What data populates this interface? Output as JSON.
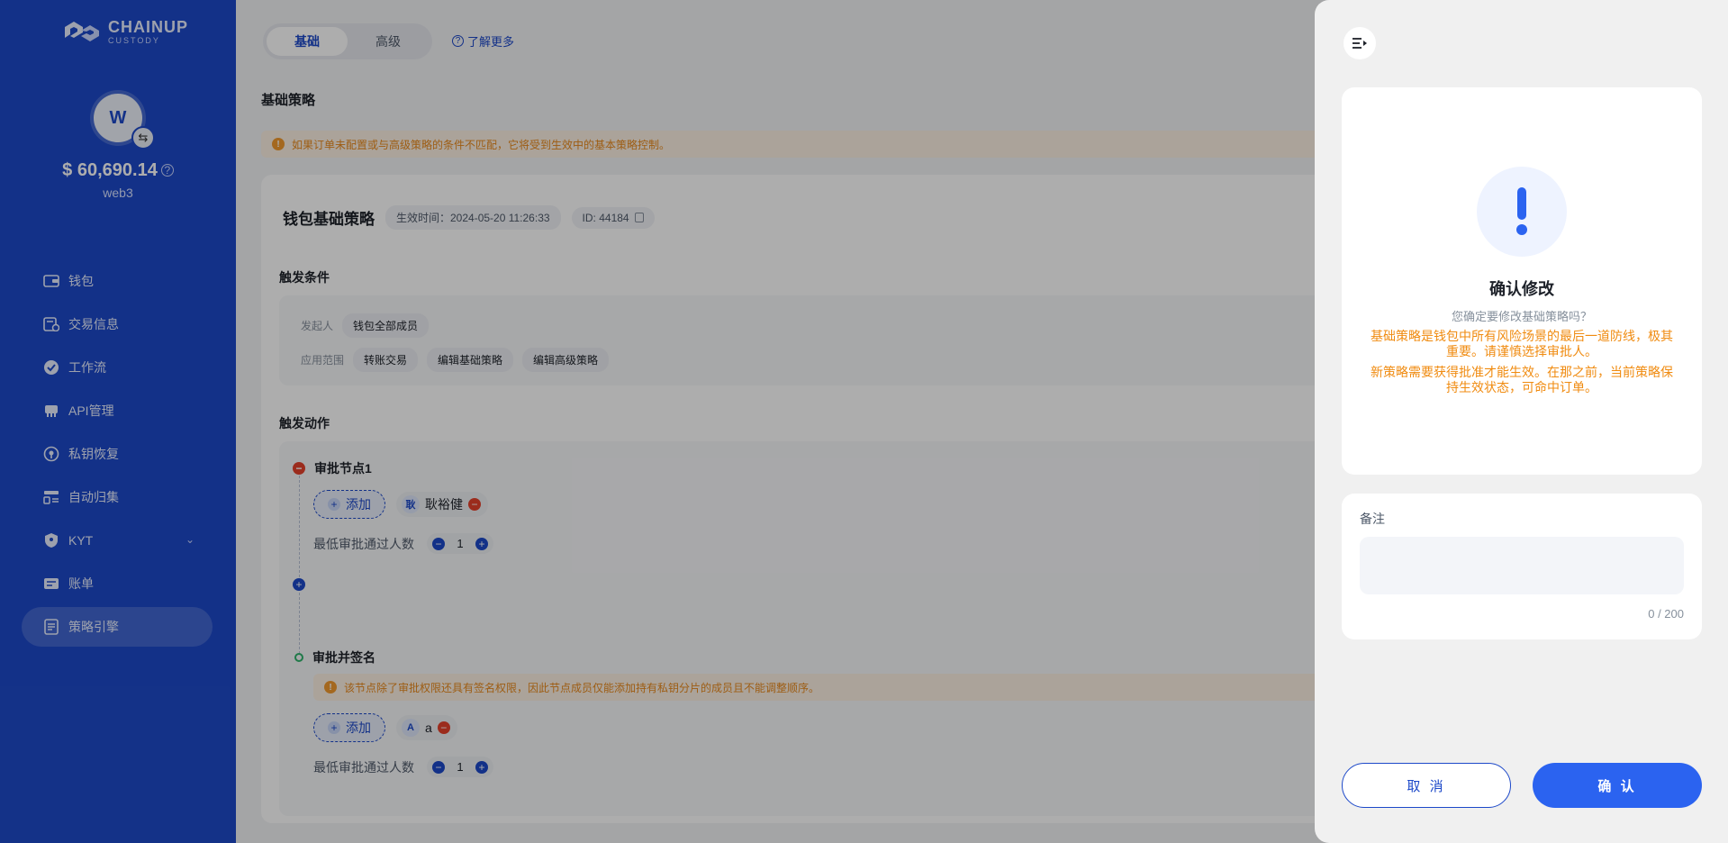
{
  "brand": {
    "name": "CHAINUP",
    "sub": "CUSTODY"
  },
  "account": {
    "avatar_letter": "W",
    "balance": "$ 60,690.14",
    "wallet_name": "web3"
  },
  "sidebar": {
    "items": [
      {
        "label": "钱包",
        "icon": "wallet-icon"
      },
      {
        "label": "交易信息",
        "icon": "transaction-icon"
      },
      {
        "label": "工作流",
        "icon": "workflow-icon"
      },
      {
        "label": "API管理",
        "icon": "api-icon"
      },
      {
        "label": "私钥恢复",
        "icon": "key-recovery-icon"
      },
      {
        "label": "自动归集",
        "icon": "auto-collect-icon"
      },
      {
        "label": "KYT",
        "icon": "kyt-shield-icon"
      },
      {
        "label": "账单",
        "icon": "bill-icon"
      },
      {
        "label": "策略引擎",
        "icon": "policy-engine-icon"
      }
    ],
    "active_index": 8
  },
  "main": {
    "tabs": [
      {
        "label": "基础"
      },
      {
        "label": "高级"
      }
    ],
    "learn_more": "了解更多",
    "section_title": "基础策略",
    "notice": "如果订单未配置或与高级策略的条件不匹配，它将受到生效中的基本策略控制。",
    "policy": {
      "title": "钱包基础策略",
      "effective_time": "生效时间：2024-05-20 11:26:33",
      "id": "ID: 44184"
    },
    "trigger_conditions": {
      "title": "触发条件",
      "initiator_label": "发起人",
      "initiator_value": "钱包全部成员",
      "scope_label": "应用范围",
      "scopes": [
        "转账交易",
        "编辑基础策略",
        "编辑高级策略"
      ]
    },
    "trigger_actions": {
      "title": "触发动作",
      "node1": {
        "title": "审批节点1",
        "add_label": "添加",
        "member_initial": "耿",
        "member_name": "耿裕健",
        "min_label": "最低审批通过人数",
        "min_value": "1"
      },
      "node2": {
        "title": "审批并签名",
        "notice": "该节点除了审批权限还具有签名权限，因此节点成员仅能添加持有私钥分片的成员且不能调整顺序。",
        "add_label": "添加",
        "member_initial": "A",
        "member_name": "a",
        "min_label": "最低审批通过人数",
        "min_value": "1"
      }
    }
  },
  "drawer": {
    "title": "确认修改",
    "question": "您确定要修改基础策略吗？",
    "warning1": "基础策略是钱包中所有风险场景的最后一道防线，极其重要。请谨慎选择审批人。",
    "warning2": "新策略需要获得批准才能生效。在那之前，当前策略保持生效状态，可命中订单。",
    "note_label": "备注",
    "note_value": "",
    "note_count": "0 / 200",
    "cancel": "取 消",
    "confirm": "确 认"
  }
}
